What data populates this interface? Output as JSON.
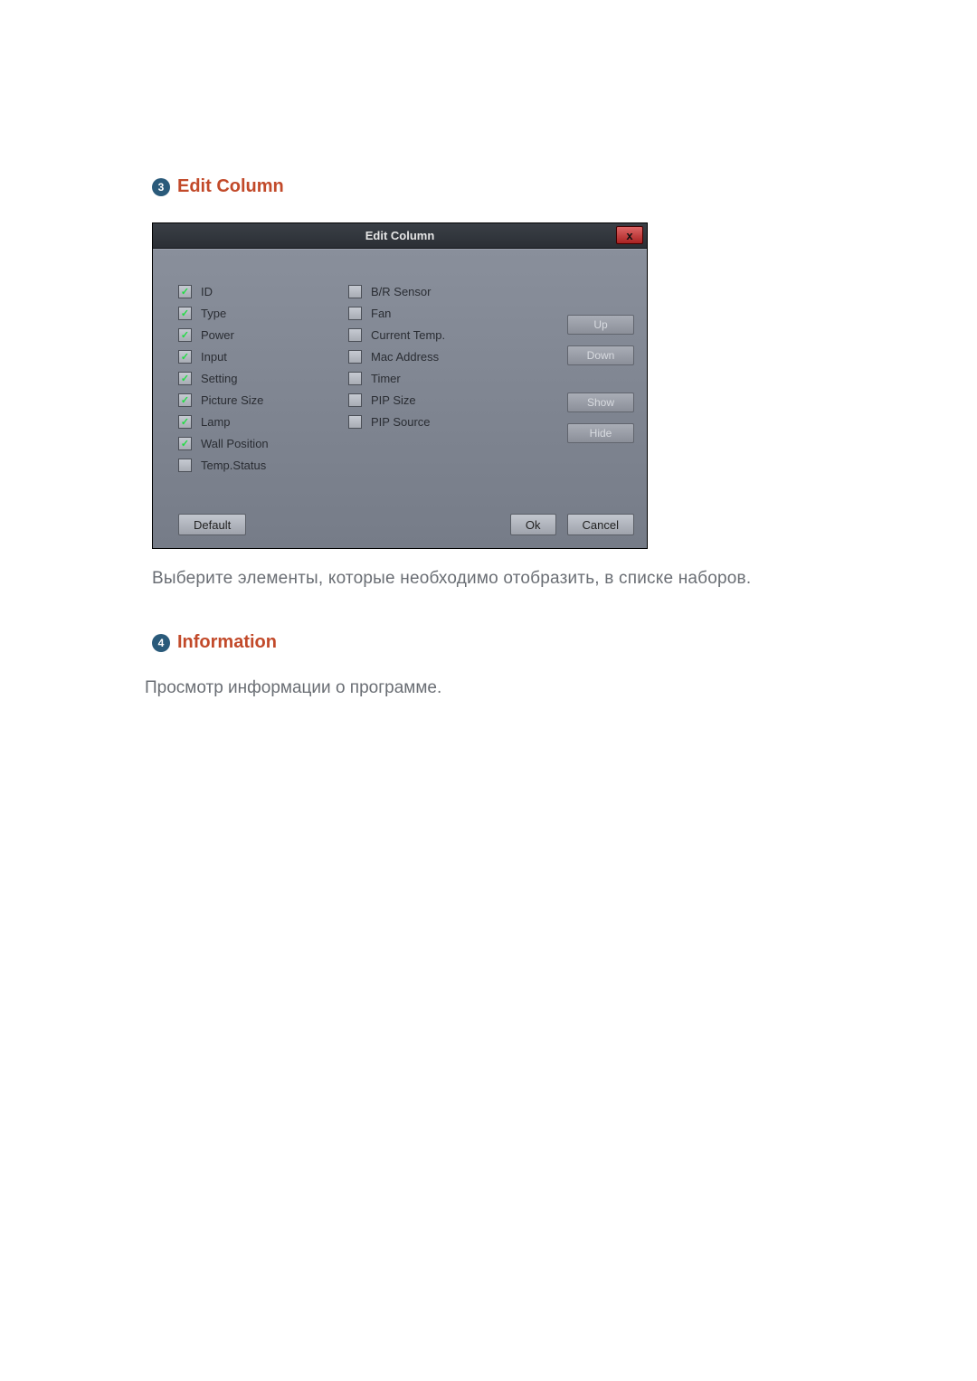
{
  "section3": {
    "bullet": "3",
    "title": "Edit Column"
  },
  "dialog": {
    "title": "Edit Column",
    "close_glyph": "x",
    "left_items": [
      {
        "label": "ID",
        "checked": true
      },
      {
        "label": "Type",
        "checked": true
      },
      {
        "label": "Power",
        "checked": true
      },
      {
        "label": "Input",
        "checked": true
      },
      {
        "label": "Setting",
        "checked": true
      },
      {
        "label": "Picture Size",
        "checked": true
      },
      {
        "label": "Lamp",
        "checked": true
      },
      {
        "label": "Wall Position",
        "checked": true
      },
      {
        "label": "Temp.Status",
        "checked": false
      }
    ],
    "right_items": [
      {
        "label": "B/R Sensor",
        "checked": false
      },
      {
        "label": "Fan",
        "checked": false
      },
      {
        "label": "Current Temp.",
        "checked": false
      },
      {
        "label": "Mac Address",
        "checked": false
      },
      {
        "label": "Timer",
        "checked": false
      },
      {
        "label": "PIP Size",
        "checked": false
      },
      {
        "label": "PIP Source",
        "checked": false
      }
    ],
    "side_buttons": {
      "up": "Up",
      "down": "Down",
      "show": "Show",
      "hide": "Hide"
    },
    "footer": {
      "default": "Default",
      "ok": "Ok",
      "cancel": "Cancel"
    }
  },
  "caption3": "Выберите элементы, которые необходимо отобразить, в списке наборов.",
  "section4": {
    "bullet": "4",
    "title": "Information"
  },
  "caption4": "Просмотр информации о программе."
}
